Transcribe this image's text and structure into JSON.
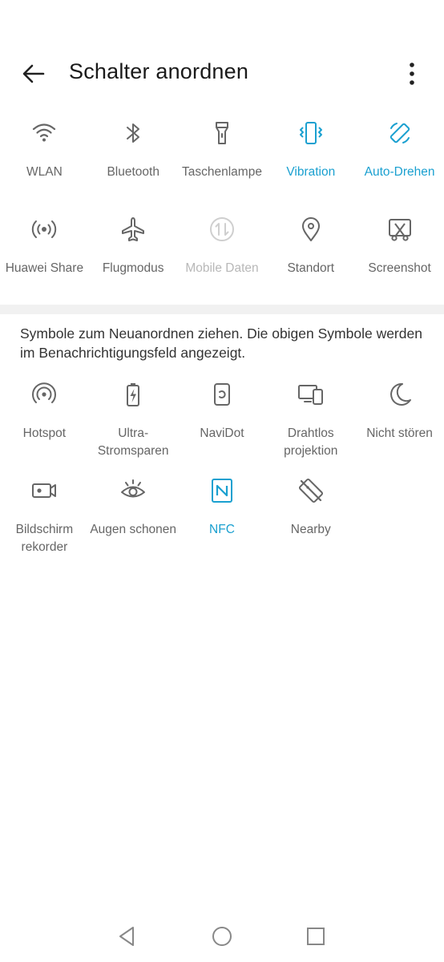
{
  "header": {
    "title": "Schalter anordnen"
  },
  "active_tiles": [
    {
      "label": "WLAN",
      "icon": "wifi-icon",
      "state": "normal"
    },
    {
      "label": "Bluetooth",
      "icon": "bluetooth-icon",
      "state": "normal"
    },
    {
      "label": "Taschenlampe",
      "icon": "flashlight-icon",
      "state": "normal"
    },
    {
      "label": "Vibration",
      "icon": "vibration-icon",
      "state": "active"
    },
    {
      "label": "Auto-Drehen",
      "icon": "auto-rotate-icon",
      "state": "active"
    },
    {
      "label": "Huawei Share",
      "icon": "huawei-share-icon",
      "state": "normal"
    },
    {
      "label": "Flugmodus",
      "icon": "airplane-icon",
      "state": "normal"
    },
    {
      "label": "Mobile Daten",
      "icon": "mobile-data-icon",
      "state": "disabled"
    },
    {
      "label": "Standort",
      "icon": "location-icon",
      "state": "normal"
    },
    {
      "label": "Screenshot",
      "icon": "screenshot-icon",
      "state": "normal"
    }
  ],
  "hint": "Symbole zum Neuanordnen ziehen. Die obigen Symbole werden im Benachrichtigungsfeld angezeigt.",
  "inactive_tiles": [
    {
      "label": "Hotspot",
      "icon": "hotspot-icon",
      "state": "normal"
    },
    {
      "label": "Ultra-\nStromsparen",
      "icon": "battery-saver-icon",
      "state": "normal"
    },
    {
      "label": "NaviDot",
      "icon": "navidot-icon",
      "state": "normal"
    },
    {
      "label": "Drahtlos\nprojektion",
      "icon": "wireless-projection-icon",
      "state": "normal"
    },
    {
      "label": "Nicht stören",
      "icon": "moon-icon",
      "state": "normal"
    },
    {
      "label": "Bildschirm\nrekorder",
      "icon": "screen-recorder-icon",
      "state": "normal"
    },
    {
      "label": "Augen schonen",
      "icon": "eye-comfort-icon",
      "state": "normal"
    },
    {
      "label": "NFC",
      "icon": "nfc-icon",
      "state": "active"
    },
    {
      "label": "Nearby",
      "icon": "nearby-icon",
      "state": "normal"
    }
  ],
  "colors": {
    "accent": "#1aa0d0",
    "icon": "#666666",
    "disabled": "#cfcfcf",
    "divider": "#f1f1f1"
  }
}
